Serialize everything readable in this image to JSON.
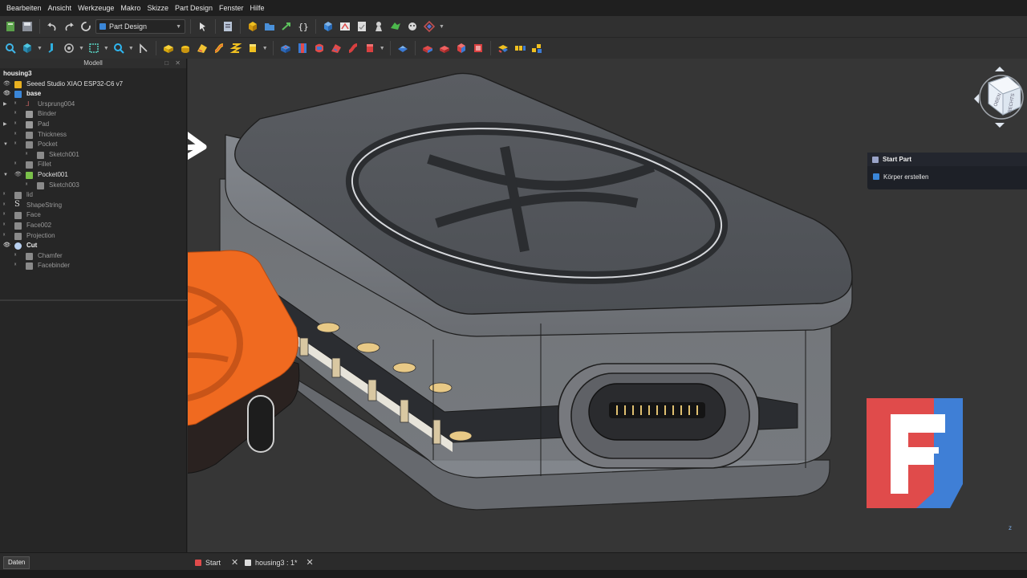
{
  "menubar": {
    "items": [
      {
        "label": "Bearbeiten"
      },
      {
        "label": "Ansicht"
      },
      {
        "label": "Werkzeuge"
      },
      {
        "label": "Makro"
      },
      {
        "label": "Skizze"
      },
      {
        "label": "Part Design"
      },
      {
        "label": "Fenster"
      },
      {
        "label": "Hilfe"
      }
    ]
  },
  "workbench": {
    "selected": "Part Design"
  },
  "panel": {
    "title": "Modell"
  },
  "tree": {
    "items": [
      {
        "label": "housing3"
      },
      {
        "label": "Seeed Studio XIAO ESP32-C6 v7"
      },
      {
        "label": "base"
      },
      {
        "label": "Ursprung004"
      },
      {
        "label": "Binder"
      },
      {
        "label": "Pad"
      },
      {
        "label": "Thickness"
      },
      {
        "label": "Pocket"
      },
      {
        "label": "Sketch001"
      },
      {
        "label": "Fillet"
      },
      {
        "label": "Pocket001"
      },
      {
        "label": "Sketch003"
      },
      {
        "label": "lid"
      },
      {
        "label": "ShapeString"
      },
      {
        "label": "Face"
      },
      {
        "label": "Face002"
      },
      {
        "label": "Projection"
      },
      {
        "label": "Cut"
      },
      {
        "label": "Chamfer"
      },
      {
        "label": "Facebinder"
      }
    ]
  },
  "navcube": {
    "faces": [
      "OBEN",
      "RECHTS"
    ]
  },
  "taskpanel": {
    "title": "Start Part",
    "item": "Körper erstellen"
  },
  "tabs": [
    {
      "label": "Start"
    },
    {
      "label": "housing3 : 1*"
    }
  ],
  "datatab": {
    "label": "Daten"
  },
  "colors": {
    "accent_blue": "#3a86d8",
    "freecad_red": "#e04b4b",
    "freecad_blue": "#3f7fd6",
    "print_orange": "#f06a20",
    "housing_gray": "#6a6d72"
  }
}
